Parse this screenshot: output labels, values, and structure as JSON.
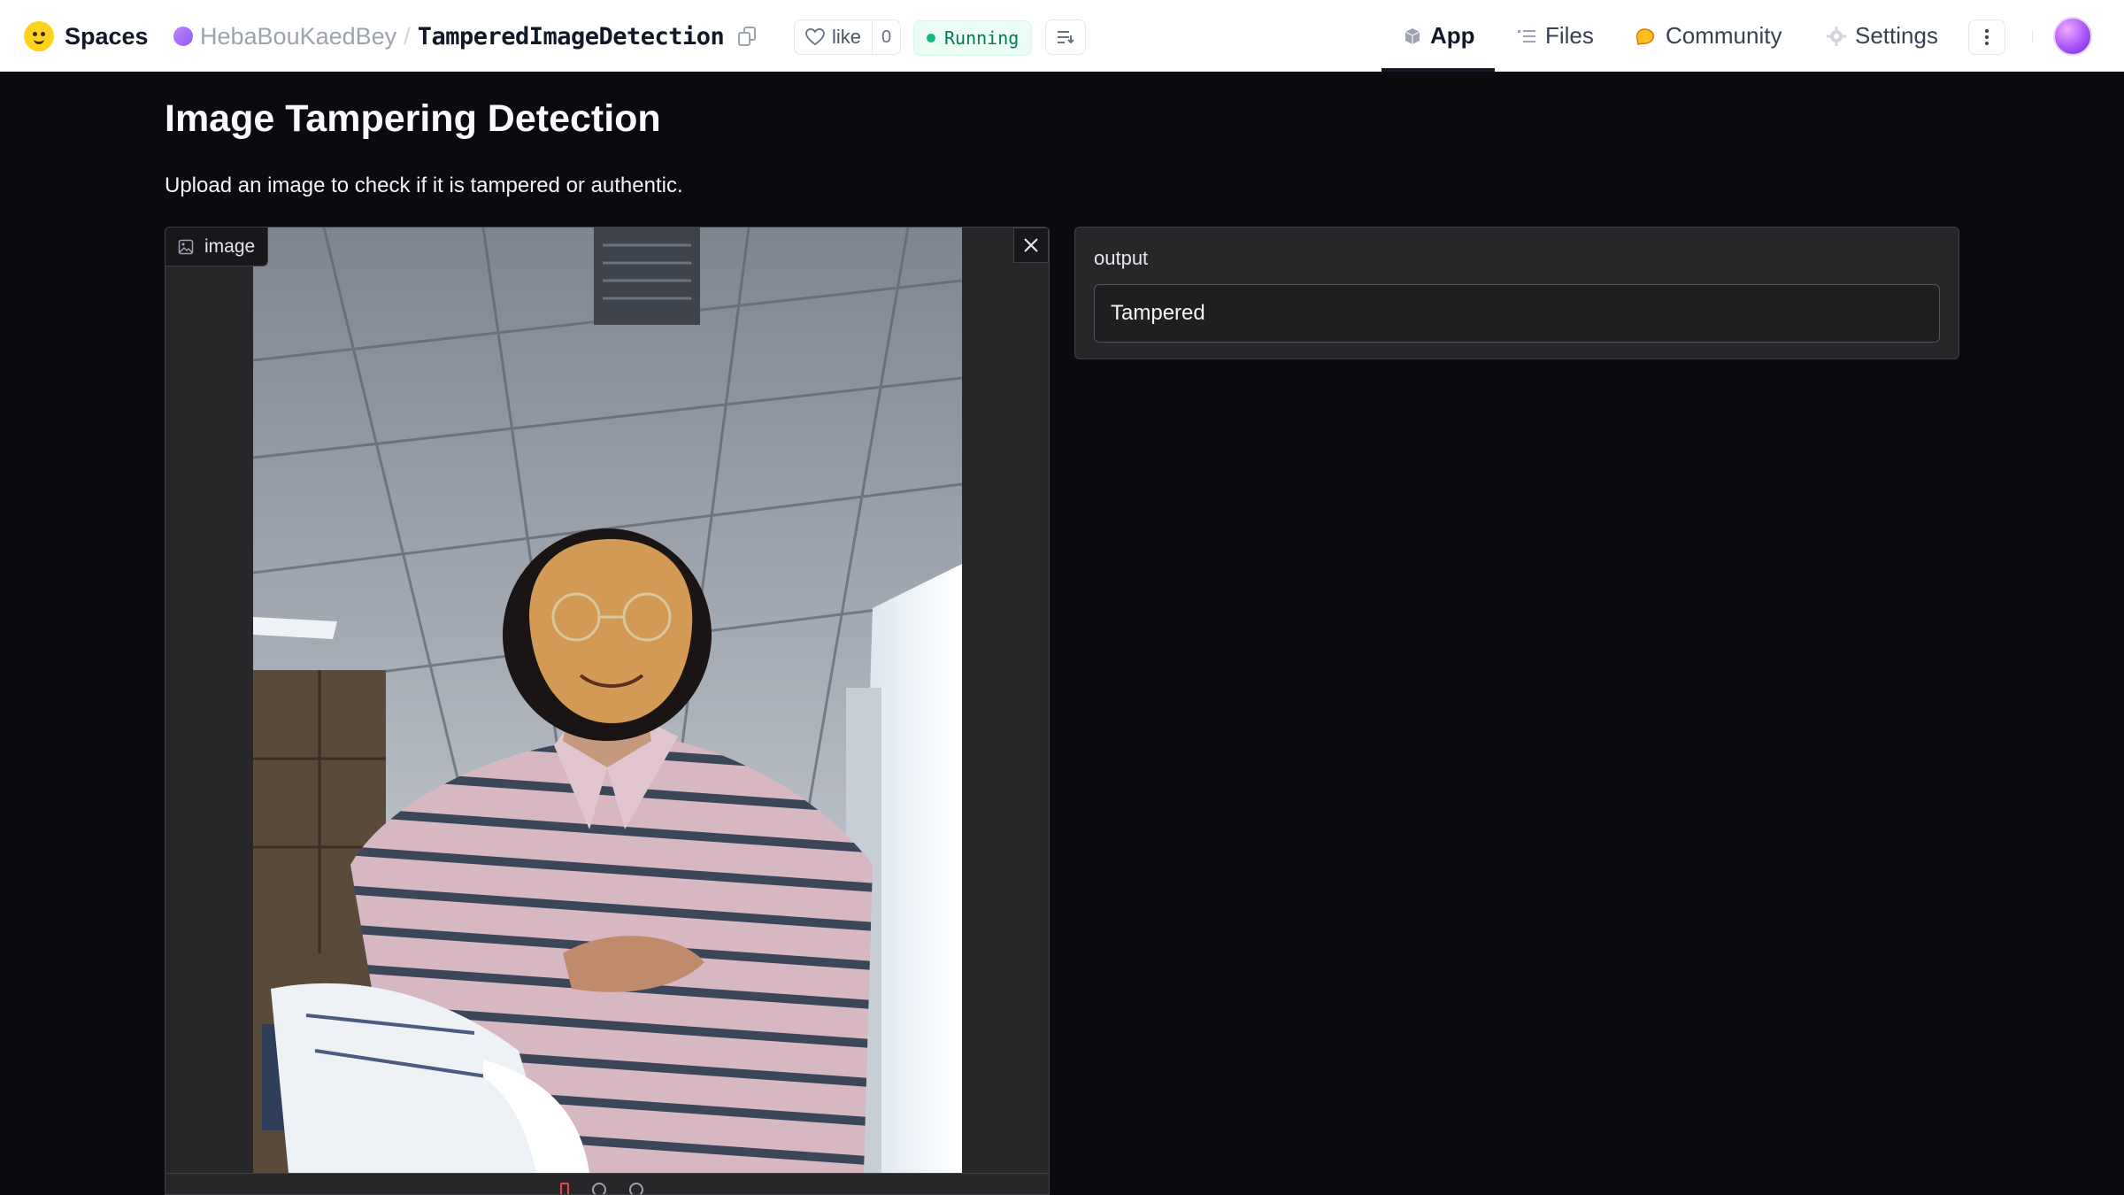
{
  "header": {
    "brand": "Spaces",
    "owner": "HebaBouKaedBey",
    "separator": "/",
    "repo": "TamperedImageDetection",
    "like_label": "like",
    "like_count": "0",
    "status": "Running",
    "tabs": [
      {
        "label": "App",
        "icon": "cube-icon",
        "active": true
      },
      {
        "label": "Files",
        "icon": "files-icon",
        "active": false
      },
      {
        "label": "Community",
        "icon": "community-icon",
        "active": false
      },
      {
        "label": "Settings",
        "icon": "gear-icon",
        "active": false
      }
    ]
  },
  "app": {
    "title": "Image Tampering Detection",
    "description": "Upload an image to check if it is tampered or authentic.",
    "input": {
      "label": "image"
    },
    "output": {
      "label": "output",
      "value": "Tampered"
    }
  },
  "colors": {
    "background": "#0b0b0f",
    "panel": "#27272a",
    "status_green": "#10b981",
    "brand_yellow": "#ffd21e"
  }
}
